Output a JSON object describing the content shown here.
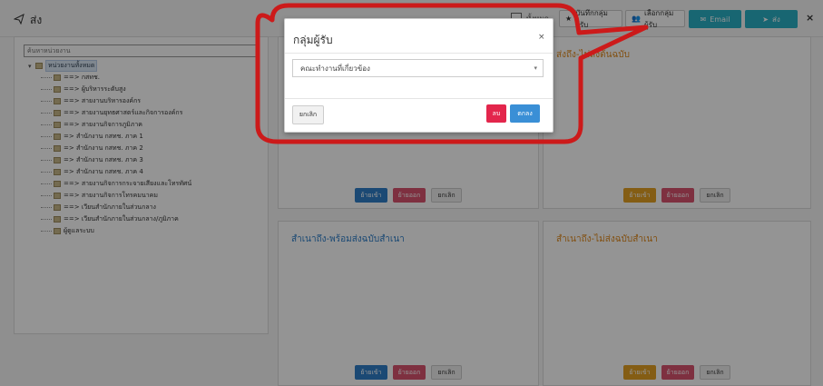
{
  "header": {
    "title": "ส่ง",
    "checkbox_label": "ทั้งหมด",
    "save_group_label": "บันทึกกลุ่มผู้รับ",
    "select_group_label": "เลือกกลุ่มผู้รับ",
    "email_label": "Email",
    "send_label": "ส่ง"
  },
  "tree": {
    "search_placeholder": "ค้นหาหน่วยงาน",
    "root_label": "หน่วยงานทั้งหมด",
    "items": [
      "==> กสทช.",
      "==> ผู้บริหารระดับสูง",
      "==> สายงานบริหารองค์กร",
      "==> สายงานยุทธศาสตร์และกิจการองค์กร",
      "==> สายงานกิจการภูมิภาค",
      "=> สำนักงาน กสทช. ภาค 1",
      "=> สำนักงาน กสทช. ภาค 2",
      "=> สำนักงาน กสทช. ภาค 3",
      "=> สำนักงาน กสทช. ภาค 4",
      "==> สายงานกิจการกระจายเสียงและโทรทัศน์",
      "==> สายงานกิจการโทรคมนาคม",
      "==> เวียนสำนักภายในส่วนกลาง",
      "==> เวียนสำนักภายในส่วนกลาง/ภูมิภาค",
      "ผู้ดูแลระบบ"
    ]
  },
  "cards": {
    "top_right_title": "ส่งถึง-ไม่ส่งต้นฉบับ",
    "bottom_left_title": "สำเนาถึง-พร้อมส่งฉบับสำเนา",
    "bottom_right_title": "สำเนาถึง-ไม่ส่งฉบับสำเนา",
    "btn_in": "ย้ายเข้า",
    "btn_out": "ย้ายออก",
    "btn_cancel": "ยกเลิก"
  },
  "modal": {
    "title": "กลุ่มผู้รับ",
    "close": "×",
    "selected": "คณะทำงานที่เกี่ยวข้อง",
    "cancel": "ยกเลิก",
    "delete": "ลบ",
    "ok": "ตกลง"
  },
  "colors": {
    "accent": "#2ab0c5",
    "annotation": "#cc1a1a",
    "card_title_orange": "#e08a1e",
    "card_title_blue": "#2f7fc9"
  }
}
